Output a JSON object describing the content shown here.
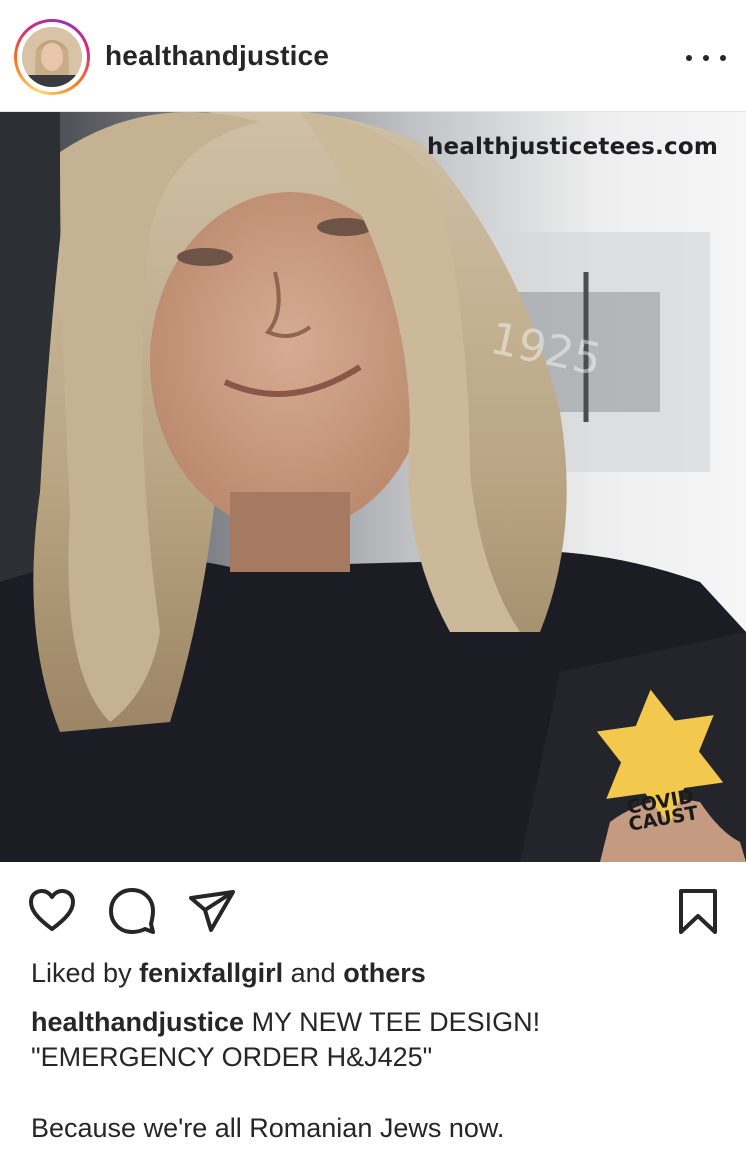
{
  "post": {
    "username": "healthandjustice",
    "watermark": "healthjusticetees.com",
    "star_line1": "COVID",
    "star_line2": "CAUST",
    "photo_sign": "1925"
  },
  "likes": {
    "prefix": "Liked by",
    "user": "fenixfallgirl",
    "middle": "and",
    "others": "others"
  },
  "caption": {
    "username": "healthandjustice",
    "line1": "MY NEW TEE DESIGN!",
    "line2": "\"EMERGENCY ORDER H&J425\"",
    "line3": "Because we're all Romanian Jews now."
  },
  "icons": {
    "avatar": "avatar",
    "more": "more-options-icon",
    "like": "heart-icon",
    "comment": "comment-icon",
    "share": "share-icon",
    "save": "bookmark-icon"
  },
  "colors": {
    "text": "#262626",
    "star": "#f2c94c",
    "shirt": "#1c1c24"
  }
}
